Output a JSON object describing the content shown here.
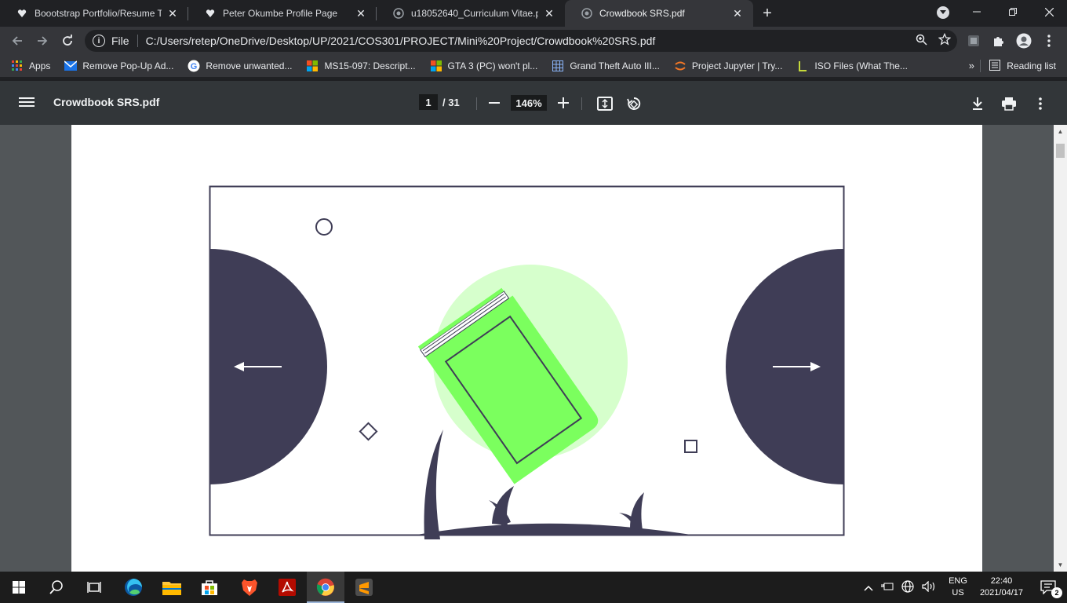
{
  "tabs": [
    {
      "title": "Boootstrap Portfolio/Resume Theme",
      "icon": "heart-icon",
      "active": false
    },
    {
      "title": "Peter Okumbe Profile Page",
      "icon": "heart-icon",
      "active": false
    },
    {
      "title": "u18052640_Curriculum Vitae.pdf",
      "icon": "globe-icon",
      "active": false
    },
    {
      "title": "Crowdbook SRS.pdf",
      "icon": "globe-icon",
      "active": true
    }
  ],
  "newtab_label": "+",
  "omnibox": {
    "scheme": "File",
    "url": "C:/Users/retep/OneDrive/Desktop/UP/2021/COS301/PROJECT/Mini%20Project/Crowdbook%20SRS.pdf"
  },
  "bookmarks": [
    {
      "label": "Apps",
      "icon": "apps-grid-icon"
    },
    {
      "label": "Remove Pop-Up Ad...",
      "icon": "mail-check-icon"
    },
    {
      "label": "Remove unwanted...",
      "icon": "google-icon"
    },
    {
      "label": "MS15-097: Descript...",
      "icon": "microsoft-icon"
    },
    {
      "label": "GTA 3 (PC) won't pl...",
      "icon": "microsoft-icon"
    },
    {
      "label": "Grand Theft Auto III...",
      "icon": "grid-icon"
    },
    {
      "label": "Project Jupyter | Try...",
      "icon": "jupyter-icon"
    },
    {
      "label": "ISO Files (What The...",
      "icon": "lifewire-icon"
    }
  ],
  "bookmarks_more": "»",
  "reading_list": "Reading list",
  "pdf": {
    "title": "Crowdbook SRS.pdf",
    "current_page": "1",
    "total_pages": "/ 31",
    "zoom": "146%"
  },
  "taskbar": {
    "lang_primary": "ENG",
    "lang_secondary": "US",
    "time": "22:40",
    "date": "2021/04/17",
    "notification_count": "2"
  },
  "colors": {
    "book_green": "#7bff5e",
    "book_circle": "#d6ffcc",
    "dark_shape": "#3f3d56"
  }
}
